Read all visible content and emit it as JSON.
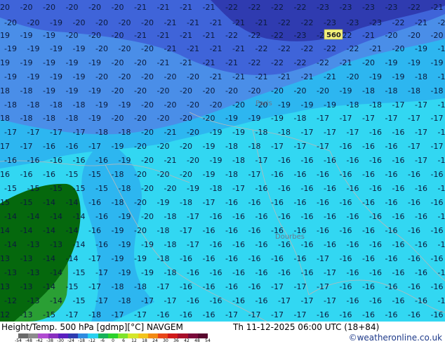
{
  "map": {
    "cities": [
      "Paris",
      "Dourbes"
    ],
    "highlight_label": "560",
    "colors": {
      "c_-24": "#2f3bb0",
      "c_-22": "#3f64d9",
      "c_-20": "#4a8ee8",
      "c_-18": "#2db6f0",
      "c_-16": "#32d7f2",
      "c_-14": "#2a9f34",
      "c_-12": "#0a7a12",
      "land": "#05680d",
      "coast": "#b8b8b8"
    }
  },
  "footer": {
    "title": "Height/Temp. 500 hPa [gdmp][°C] NAVGEM",
    "date": "Th 11-12-2025 06:00 UTC (18+84)",
    "credit": "©weatheronline.co.uk"
  },
  "colorbar": {
    "ticks": [
      "-54",
      "-48",
      "-42",
      "-38",
      "-30",
      "-24",
      "-18",
      "-12",
      "-6",
      "0",
      "6",
      "12",
      "18",
      "24",
      "30",
      "36",
      "42",
      "48",
      "54"
    ],
    "colors": [
      "#6b6b6b",
      "#8c8c8c",
      "#b04bd0",
      "#8a2fbf",
      "#5a1fbf",
      "#2f3bb0",
      "#2f8be0",
      "#2ad0ef",
      "#16b35a",
      "#2bd12b",
      "#7fe32a",
      "#d4e62a",
      "#f2c41c",
      "#f28a14",
      "#e8471a",
      "#d11a1a",
      "#a80f2a",
      "#7a0a3a",
      "#58082e"
    ]
  }
}
